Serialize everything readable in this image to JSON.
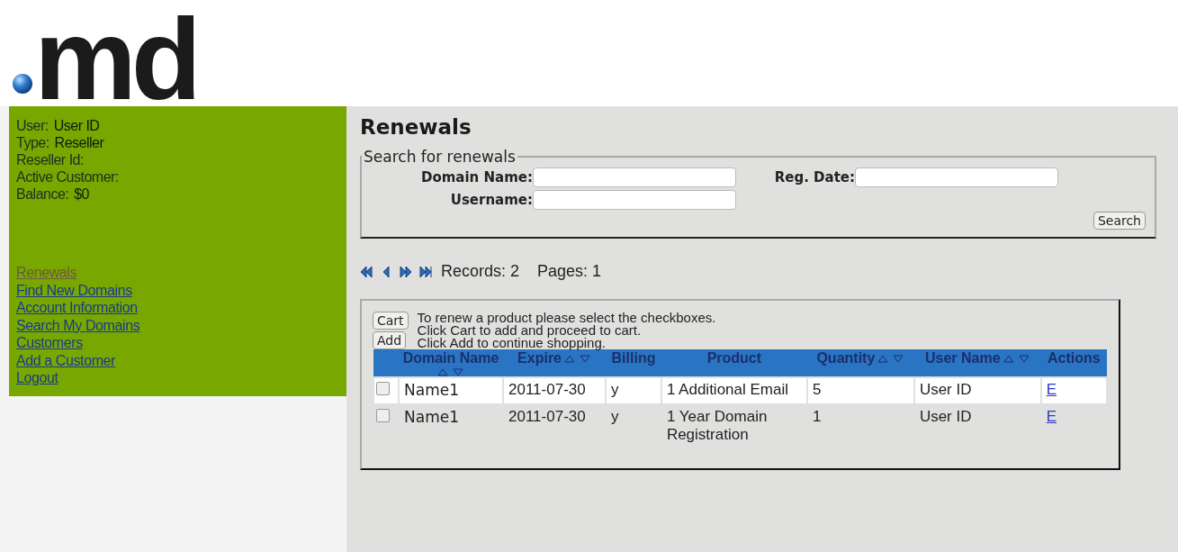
{
  "logo": {
    "text": "md"
  },
  "account": [
    {
      "label": "User:",
      "value": "User ID"
    },
    {
      "label": "Type:",
      "value": "Reseller"
    },
    {
      "label": "Reseller Id:"
    },
    {
      "label": "Active Customer:"
    },
    {
      "label": "Balance:",
      "value": "$0"
    }
  ],
  "nav": [
    {
      "label": "Renewals",
      "selected": true
    },
    {
      "label": "Find New Domains",
      "selected": false
    },
    {
      "label": "Account Information",
      "selected": false
    },
    {
      "label": "Search My Domains",
      "selected": false
    },
    {
      "label": "Customers",
      "selected": false
    },
    {
      "label": "Add a Customer",
      "selected": false
    },
    {
      "label": "Logout",
      "selected": false
    }
  ],
  "page_title": "Renewals",
  "search": {
    "legend": "Search for renewals",
    "fields": [
      {
        "label": "Domain Name:"
      },
      {
        "label": "Reg. Date:"
      },
      {
        "label": "Username:"
      }
    ],
    "button": "Search"
  },
  "pager": {
    "records": "Records: 2",
    "pages": "Pages: 1"
  },
  "cart": {
    "buttons": [
      "Cart",
      "Add"
    ],
    "instructions": [
      "To renew a product please select the checkboxes.",
      "Click Cart to add and proceed to cart.",
      "Click Add to continue shopping."
    ]
  },
  "table": {
    "columns": [
      {
        "label": "Domain Name",
        "sortable": true
      },
      {
        "label": "Expire",
        "sortable": true
      },
      {
        "label": "Billing",
        "sortable": false
      },
      {
        "label": "Product",
        "sortable": false
      },
      {
        "label": "Quantity",
        "sortable": true
      },
      {
        "label": "User Name",
        "sortable": true
      },
      {
        "label": "Actions",
        "sortable": false
      }
    ],
    "rows": [
      {
        "checked": false,
        "cells": [
          "Name1",
          "2011-07-30",
          "y",
          "1 Additional Email",
          "5",
          "User ID"
        ],
        "action": "E"
      },
      {
        "checked": false,
        "cells": [
          "Name1",
          "2011-07-30",
          "y",
          "1 Year Domain Registration",
          "1",
          "User ID"
        ],
        "action": "E"
      }
    ]
  }
}
